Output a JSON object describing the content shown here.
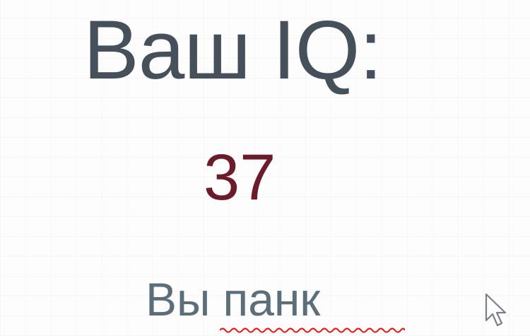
{
  "title": "Ваш IQ:",
  "score": "37",
  "verdict": {
    "prefix": "Вы",
    "word": "панк"
  },
  "colors": {
    "title": "#46505a",
    "score": "#6c1b2a",
    "verdict": "#5c6e7a",
    "spellcheck_underline": "#e02020"
  },
  "icons": {
    "pointer": "mouse-pointer-icon",
    "spellcheck": "spellcheck-underline"
  }
}
